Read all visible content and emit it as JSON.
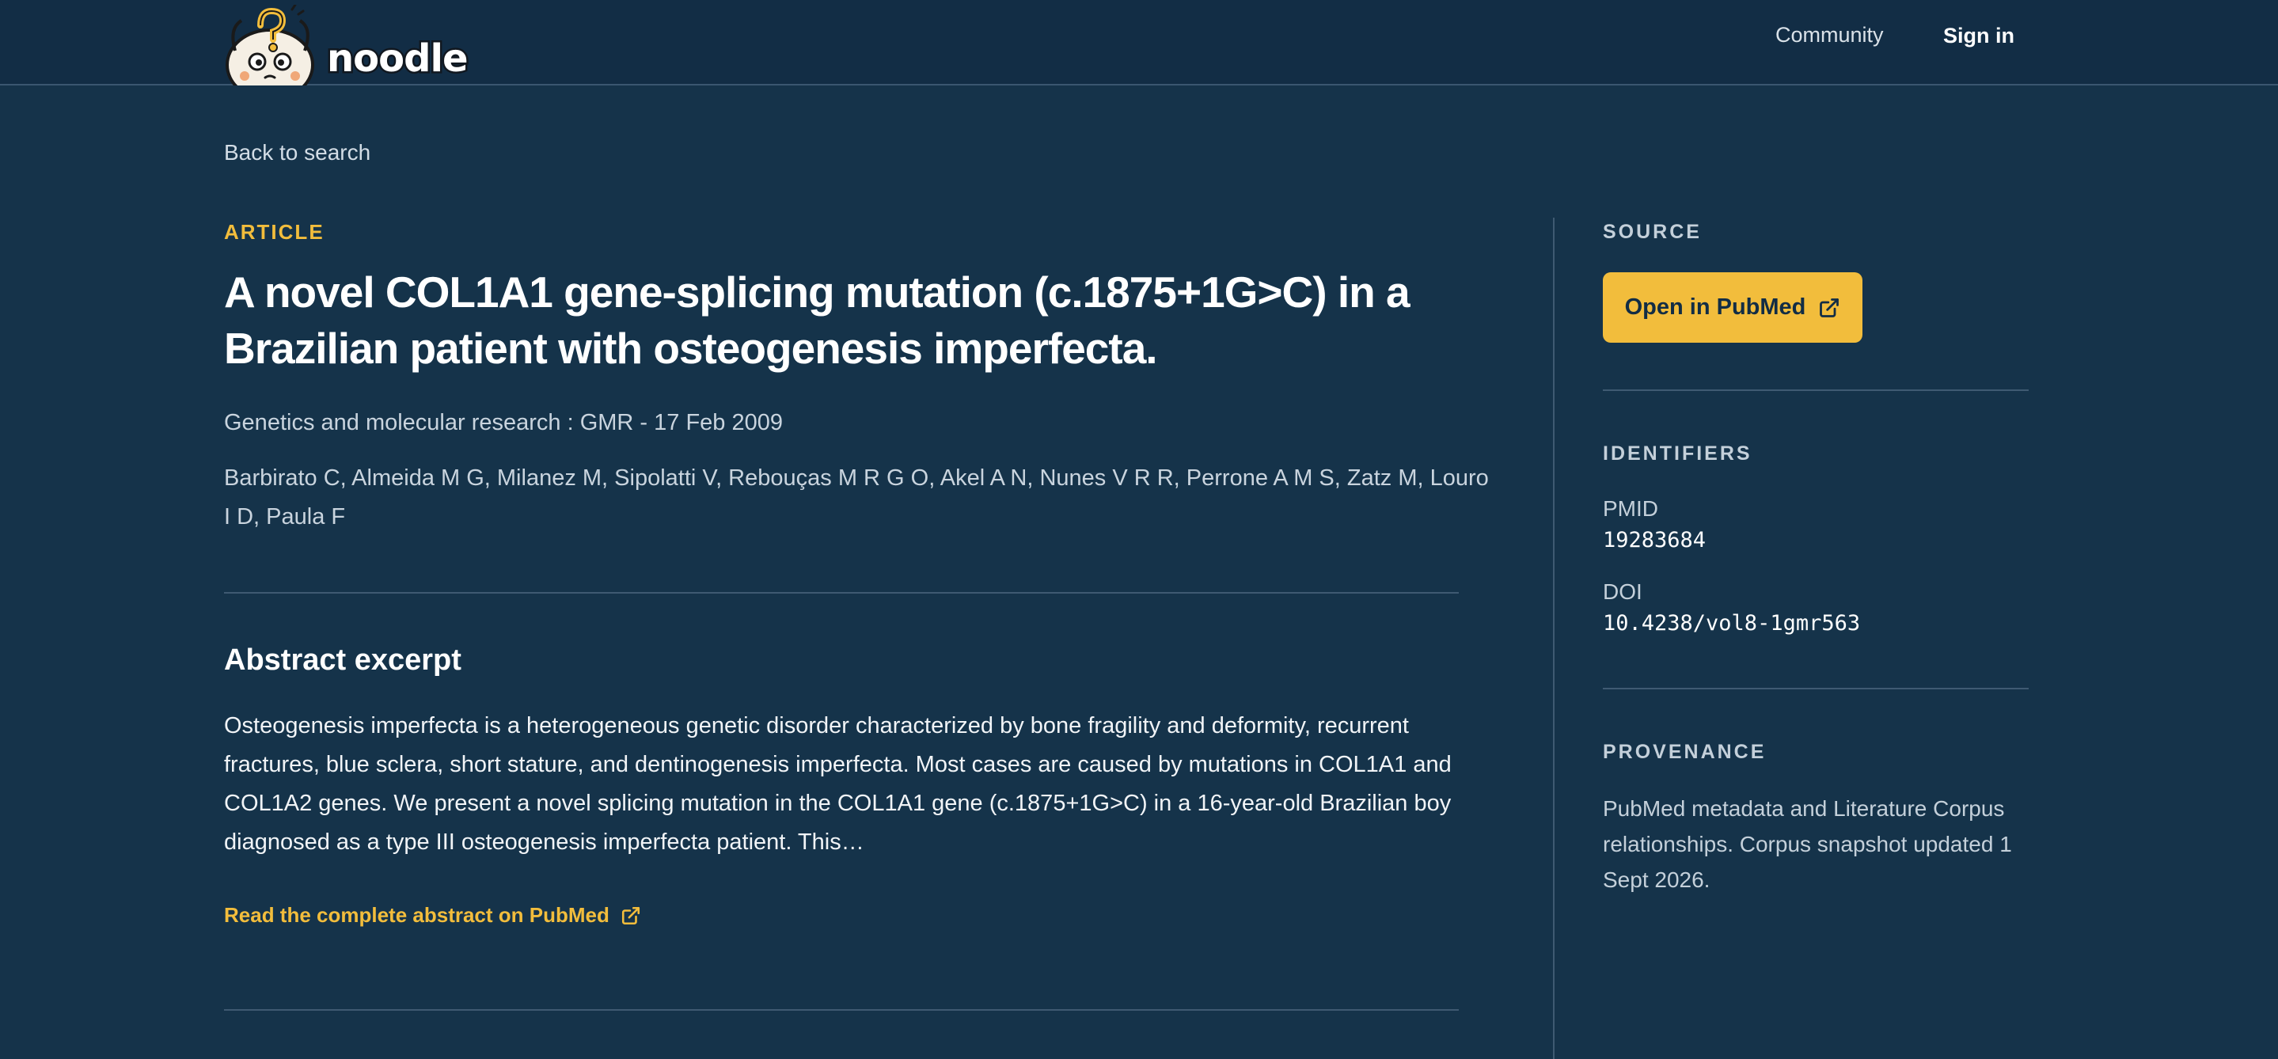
{
  "app": {
    "brand_name": "noodle"
  },
  "nav": {
    "community_label": "Community",
    "sign_in_label": "Sign in"
  },
  "back_link": "Back to search",
  "article": {
    "kind": "ARTICLE",
    "title": "A novel COL1A1 gene-splicing mutation (c.1875+1G>C) in a Brazilian patient with osteogenesis imperfecta.",
    "journal_line": "Genetics and molecular research : GMR - 17 Feb 2009",
    "authors": "Barbirato C, Almeida M G, Milanez M, Sipolatti V, Rebouças M R G O, Akel A N, Nunes V R R, Perrone A M S, Zatz M, Louro I D, Paula F"
  },
  "abstract": {
    "heading": "Abstract excerpt",
    "text": "Osteogenesis imperfecta is a heterogeneous genetic disorder characterized by bone fragility and deformity, recurrent fractures, blue sclera, short stature, and dentinogenesis imperfecta. Most cases are caused by mutations in COL1A1 and COL1A2 genes. We present a novel splicing mutation in the COL1A1 gene (c.1875+1G>C) in a 16-year-old Brazilian boy diagnosed as a type III osteogenesis imperfecta patient. This…",
    "read_more_label": "Read the complete abstract on PubMed"
  },
  "sidebar": {
    "source_label": "SOURCE",
    "open_button_label": "Open in PubMed",
    "identifiers_label": "IDENTIFIERS",
    "pmid_label": "PMID",
    "pmid_value": "19283684",
    "doi_label": "DOI",
    "doi_value": "10.4238/vol8-1gmr563",
    "provenance_label": "PROVENANCE",
    "provenance_text": "PubMed metadata and Literature Corpus relationships. Corpus snapshot updated 1 Sept 2026."
  },
  "icons": {
    "external_link": "external-link-icon",
    "mascot": "noodle-mascot-logo"
  },
  "colors": {
    "page_background": "#15334a",
    "header_background": "#122d45",
    "accent": "#f2bd3c",
    "divider": "#3f5a72",
    "muted_text": "#c4d0da"
  }
}
